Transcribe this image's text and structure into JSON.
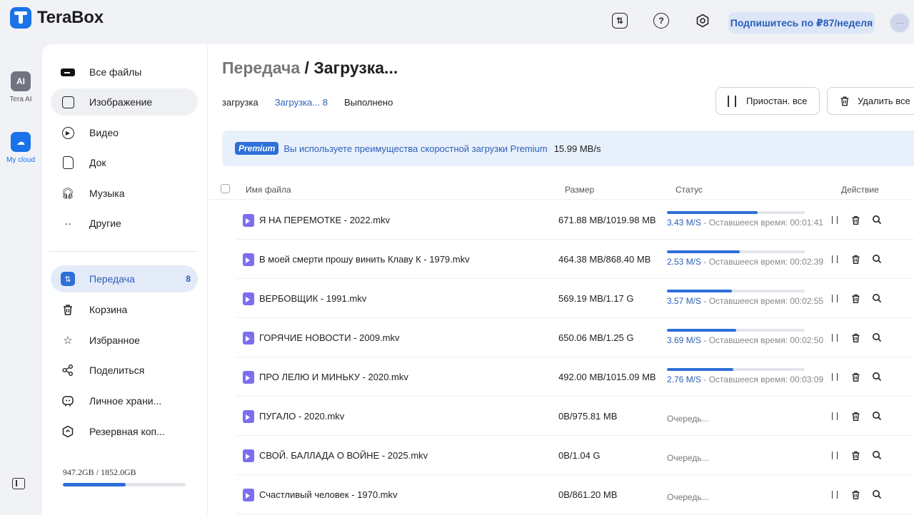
{
  "app": {
    "name": "TeraBox",
    "subscribe_label": "Подпишитесь по ₽87/неделя",
    "avatar_text": "···"
  },
  "rail": {
    "items": [
      {
        "label": "Tera AI",
        "badge": "AI"
      },
      {
        "label": "My cloud",
        "badge": "☁"
      }
    ]
  },
  "sidebar": {
    "categories": [
      {
        "label": "Все файлы",
        "icon": "all-files-icon"
      },
      {
        "label": "Изображение",
        "icon": "image-icon"
      },
      {
        "label": "Видео",
        "icon": "video-icon"
      },
      {
        "label": "Док",
        "icon": "doc-icon"
      },
      {
        "label": "Музыка",
        "icon": "headphones-icon"
      },
      {
        "label": "Другие",
        "icon": "more-icon"
      }
    ],
    "tools": [
      {
        "label": "Передача",
        "icon": "transfer-icon",
        "count": "8"
      },
      {
        "label": "Корзина",
        "icon": "trash-icon"
      },
      {
        "label": "Избранное",
        "icon": "star-icon"
      },
      {
        "label": "Поделиться",
        "icon": "share-icon"
      },
      {
        "label": "Личное храни...",
        "icon": "private-vault-icon"
      },
      {
        "label": "Резервная коп...",
        "icon": "backup-icon"
      }
    ],
    "storage": {
      "text": "947.2GB / 1852.0GB",
      "used_fraction": 0.511
    }
  },
  "main": {
    "breadcrumb": {
      "parent": "Передача",
      "separator": " / ",
      "current": "Загрузка..."
    },
    "tabs": [
      {
        "label": "загрузка"
      },
      {
        "label": "Загрузка... 8"
      },
      {
        "label": "Выполнено"
      }
    ],
    "pause_all_label": "Приостан. все",
    "delete_all_label": "Удалить все",
    "premium": {
      "badge": "Premium",
      "text": "Вы используете преимущества скоростной загрузки Premium",
      "speed": "15.99 MB/s"
    },
    "columns": {
      "name": "Имя файла",
      "size": "Размер",
      "status": "Статус",
      "action": "Действие"
    },
    "files": [
      {
        "name": "Я НА ПЕРЕМОТКЕ - 2022.mkv",
        "size": "671.88 MB/1019.98 MB",
        "progress": 0.66,
        "speed": "3.43 M/S",
        "remaining": " - Оставшееся время: 00:01:41"
      },
      {
        "name": "В моей смерти прошу винить Клаву К - 1979.mkv",
        "size": "464.38 MB/868.40 MB",
        "progress": 0.53,
        "speed": "2.53 M/S",
        "remaining": " - Оставшееся время: 00:02:39"
      },
      {
        "name": "ВЕРБОВЩИК - 1991.mkv",
        "size": "569.19 MB/1.17 G",
        "progress": 0.47,
        "speed": "3.57 M/S",
        "remaining": " - Оставшееся время: 00:02:55"
      },
      {
        "name": "ГОРЯЧИЕ НОВОСТИ - 2009.mkv",
        "size": "650.06 MB/1.25 G",
        "progress": 0.5,
        "speed": "3.69 M/S",
        "remaining": " - Оставшееся время: 00:02:50"
      },
      {
        "name": "ПРО ЛЕЛЮ И МИНЬКУ - 2020.mkv",
        "size": "492.00 MB/1015.09 MB",
        "progress": 0.48,
        "speed": "2.76 M/S",
        "remaining": " - Оставшееся время: 00:03:09"
      },
      {
        "name": "ПУГАЛО - 2020.mkv",
        "size": "0B/975.81 MB",
        "queue": "Очередь..."
      },
      {
        "name": "СВОЙ. БАЛЛАДА О ВОЙНЕ - 2025.mkv",
        "size": "0B/1.04 G",
        "queue": "Очередь..."
      },
      {
        "name": "Счастливый человек - 1970.mkv",
        "size": "0B/861.20 MB",
        "queue": "Очередь..."
      }
    ]
  },
  "colors": {
    "accent": "#2e6fd8",
    "accent_text": "#2c5fb9",
    "file_icon": "#7d6ef0"
  }
}
